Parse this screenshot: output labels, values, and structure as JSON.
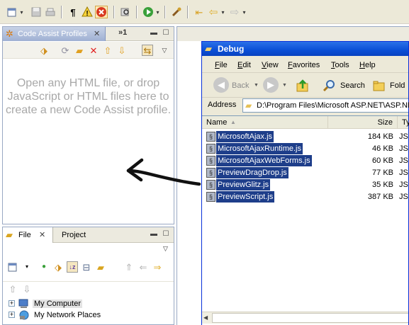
{
  "main_toolbar": {
    "icons": [
      "new-icon",
      "save-icon",
      "print-icon",
      "pilcrow-icon",
      "warning-icon",
      "error-icon",
      "search-icon",
      "run-icon",
      "external-tools-icon",
      "last-edit-icon",
      "back-icon",
      "forward-icon"
    ]
  },
  "code_assist": {
    "tab_label": "Code Assist Profiles",
    "overflow_count": "»1",
    "message": "Open any HTML file, or drop JavaScript or HTML files here to create a new Code Assist profile."
  },
  "file_panel": {
    "tabs": [
      {
        "label": "File"
      },
      {
        "label": "Project"
      }
    ],
    "tree": [
      {
        "label": "My Computer"
      },
      {
        "label": "My Network Places"
      }
    ]
  },
  "explorer": {
    "title": "Debug",
    "menu": [
      {
        "label": "File",
        "u": "F",
        "rest": "ile"
      },
      {
        "label": "Edit",
        "u": "E",
        "rest": "dit"
      },
      {
        "label": "View",
        "u": "V",
        "rest": "iew"
      },
      {
        "label": "Favorites",
        "u": "F",
        "rest": "avorites"
      },
      {
        "label": "Tools",
        "u": "T",
        "rest": "ools"
      },
      {
        "label": "Help",
        "u": "H",
        "rest": "elp"
      }
    ],
    "toolbar": {
      "back_label": "Back",
      "search_label": "Search",
      "folders_label": "Fold"
    },
    "address_label": "Address",
    "address_value": "D:\\Program Files\\Microsoft ASP.NET\\ASP.NET",
    "columns": {
      "name": "Name",
      "size": "Size",
      "type": "Ty"
    },
    "files": [
      {
        "name": "MicrosoftAjax.js",
        "size": "184 KB",
        "type": "JS"
      },
      {
        "name": "MicrosoftAjaxRuntime.js",
        "size": "46 KB",
        "type": "JS"
      },
      {
        "name": "MicrosoftAjaxWebForms.js",
        "size": "60 KB",
        "type": "JS"
      },
      {
        "name": "PreviewDragDrop.js",
        "size": "77 KB",
        "type": "JS"
      },
      {
        "name": "PreviewGlitz.js",
        "size": "35 KB",
        "type": "JS"
      },
      {
        "name": "PreviewScript.js",
        "size": "387 KB",
        "type": "JS"
      }
    ]
  },
  "colors": {
    "selection": "#1e3e8a",
    "xp_title": "#0a4fd6",
    "eclipse_active_tab": "#9fb0d3",
    "message_gray": "#a8a8a8"
  }
}
